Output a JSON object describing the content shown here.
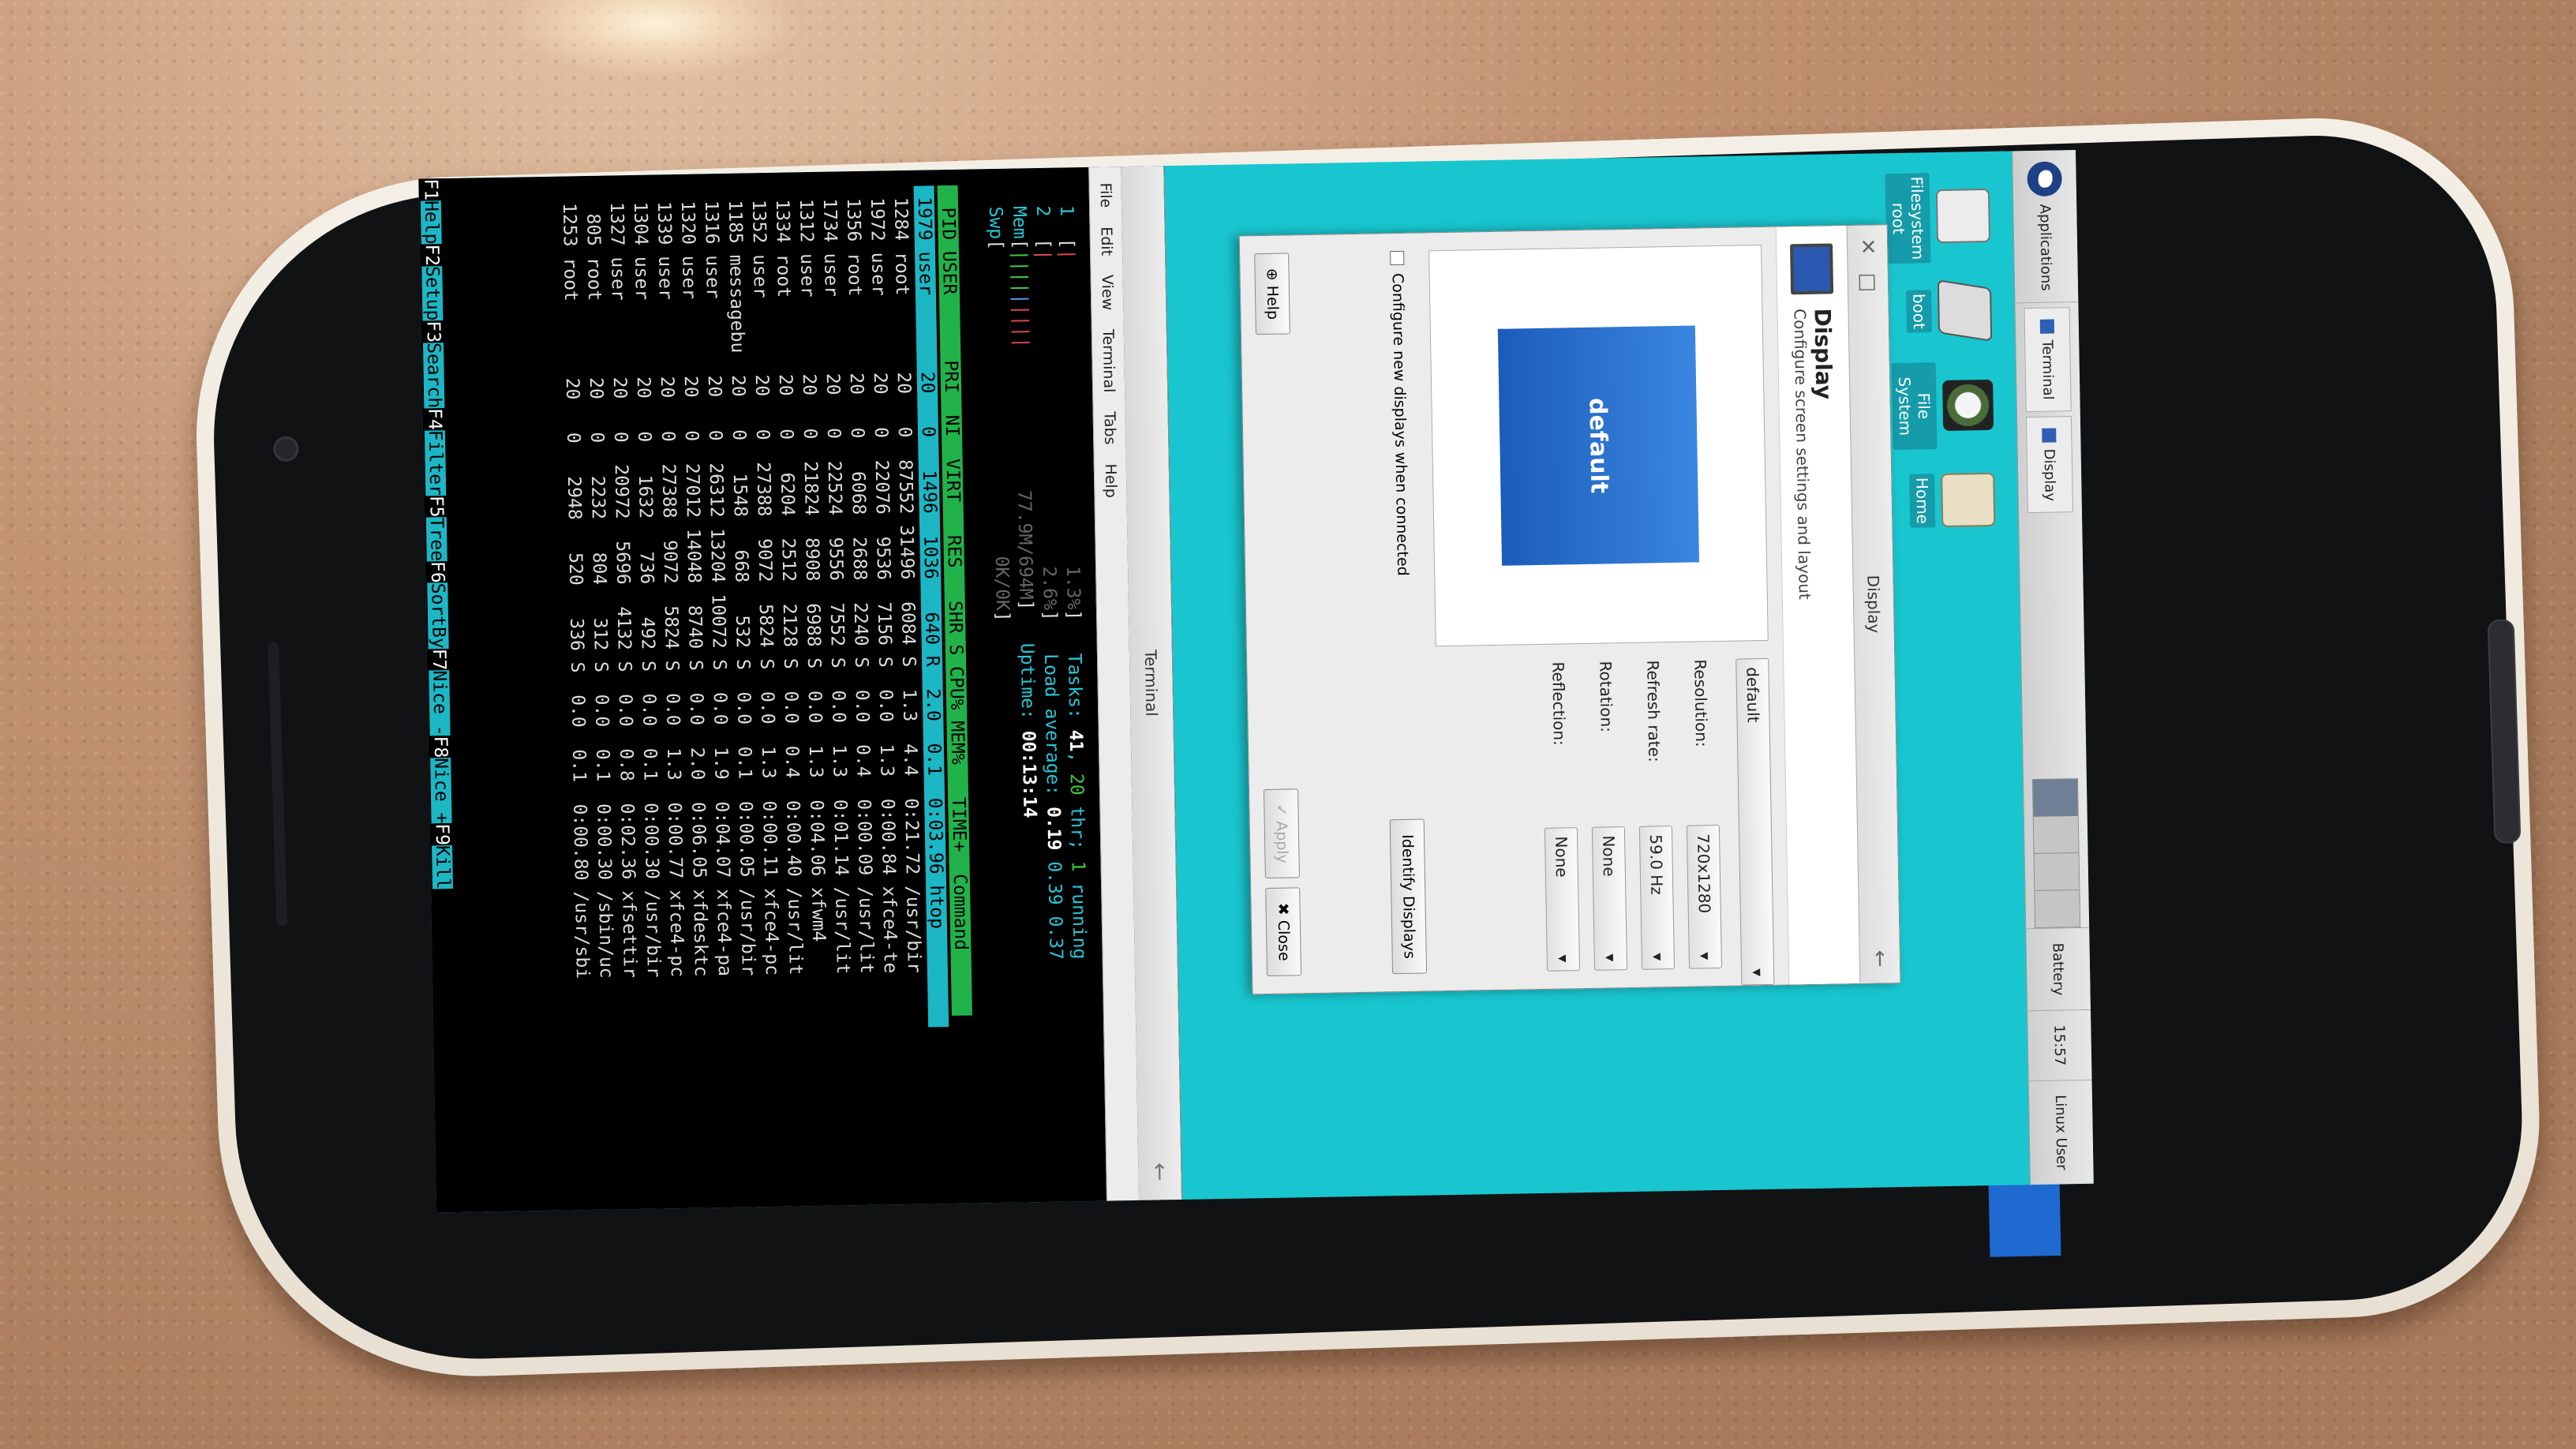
{
  "panel": {
    "applications": "Applications",
    "tasks": [
      "Terminal",
      "Display"
    ],
    "battery": "Battery",
    "clock": "15:57",
    "user": "Linux User"
  },
  "desktop_icons": [
    {
      "label": "Filesystem\nroot",
      "icon": "drive-icon"
    },
    {
      "label": "boot",
      "icon": "drive-icon"
    },
    {
      "label": "File System",
      "icon": "disk-icon"
    },
    {
      "label": "Home",
      "icon": "folder-icon"
    }
  ],
  "display_dialog": {
    "window_title": "Display",
    "heading": "Display",
    "subheading": "Configure screen settings and layout",
    "output_selected": "default",
    "preview_label": "default",
    "resolution_label": "Resolution:",
    "resolution_value": "720x1280",
    "refresh_label": "Refresh rate:",
    "refresh_value": "59.0 Hz",
    "rotation_label": "Rotation:",
    "rotation_value": "None",
    "reflection_label": "Reflection:",
    "reflection_value": "None",
    "identify_button": "Identify Displays",
    "configure_checkbox": "Configure new displays when connected",
    "help_button": "Help",
    "apply_button": "Apply",
    "close_button": "Close"
  },
  "terminal": {
    "window_title": "Terminal",
    "menu": [
      "File",
      "Edit",
      "View",
      "Terminal",
      "Tabs",
      "Help"
    ],
    "meters": {
      "cpu1": "1.3%",
      "cpu2": "2.6%",
      "mem": "77.9M/694M",
      "swp": "0K/0K"
    },
    "tasks_line": {
      "tasks": "41",
      "thr": "20",
      "running": "1"
    },
    "load_average": [
      "0.19",
      "0.39",
      "0.37"
    ],
    "uptime": "00:13:14",
    "columns": [
      "PID",
      "USER",
      "PRI",
      "NI",
      "VIRT",
      "RES",
      "SHR",
      "S",
      "CPU%",
      "MEM%",
      "TIME+",
      "Command"
    ],
    "rows": [
      [
        "1979",
        "user",
        "20",
        "0",
        "1496",
        "1036",
        "640",
        "R",
        "2.0",
        "0.1",
        "0:03.96",
        "htop"
      ],
      [
        "1284",
        "root",
        "20",
        "0",
        "87552",
        "31496",
        "6084",
        "S",
        "1.3",
        "4.4",
        "0:21.72",
        "/usr/bir"
      ],
      [
        "1972",
        "user",
        "20",
        "0",
        "22076",
        "9536",
        "7156",
        "S",
        "0.0",
        "1.3",
        "0:00.84",
        "xfce4-te"
      ],
      [
        "1356",
        "root",
        "20",
        "0",
        "6068",
        "2688",
        "2240",
        "S",
        "0.0",
        "0.4",
        "0:00.09",
        "/usr/lit"
      ],
      [
        "1734",
        "user",
        "20",
        "0",
        "22524",
        "9556",
        "7552",
        "S",
        "0.0",
        "1.3",
        "0:01.14",
        "/usr/lit"
      ],
      [
        "1312",
        "user",
        "20",
        "0",
        "21824",
        "8908",
        "6988",
        "S",
        "0.0",
        "1.3",
        "0:04.06",
        "xfwm4"
      ],
      [
        "1334",
        "root",
        "20",
        "0",
        "6204",
        "2512",
        "2128",
        "S",
        "0.0",
        "0.4",
        "0:00.40",
        "/usr/lit"
      ],
      [
        "1352",
        "user",
        "20",
        "0",
        "27388",
        "9072",
        "5824",
        "S",
        "0.0",
        "1.3",
        "0:00.11",
        "xfce4-pc"
      ],
      [
        "1185",
        "messagebu",
        "20",
        "0",
        "1548",
        "668",
        "532",
        "S",
        "0.0",
        "0.1",
        "0:00.05",
        "/usr/bir"
      ],
      [
        "1316",
        "user",
        "20",
        "0",
        "26312",
        "13204",
        "10072",
        "S",
        "0.0",
        "1.9",
        "0:04.07",
        "xfce4-pa"
      ],
      [
        "1320",
        "user",
        "20",
        "0",
        "27012",
        "14048",
        "8740",
        "S",
        "0.0",
        "2.0",
        "0:06.05",
        "xfdesktc"
      ],
      [
        "1339",
        "user",
        "20",
        "0",
        "27388",
        "9072",
        "5824",
        "S",
        "0.0",
        "1.3",
        "0:00.77",
        "xfce4-pc"
      ],
      [
        "1304",
        "user",
        "20",
        "0",
        "1632",
        "736",
        "492",
        "S",
        "0.0",
        "0.1",
        "0:00.30",
        "/usr/bir"
      ],
      [
        "1327",
        "user",
        "20",
        "0",
        "20972",
        "5696",
        "4132",
        "S",
        "0.0",
        "0.8",
        "0:02.36",
        "xfsettir"
      ],
      [
        "805",
        "root",
        "20",
        "0",
        "2232",
        "804",
        "312",
        "S",
        "0.0",
        "0.1",
        "0:00.30",
        "/sbin/uc"
      ],
      [
        "1253",
        "root",
        "20",
        "0",
        "2948",
        "520",
        "336",
        "S",
        "0.0",
        "0.1",
        "0:00.80",
        "/usr/sbi"
      ]
    ],
    "fkeys": [
      [
        "F1",
        "Help"
      ],
      [
        "F2",
        "Setup"
      ],
      [
        "F3",
        "Search"
      ],
      [
        "F4",
        "Filter"
      ],
      [
        "F5",
        "Tree"
      ],
      [
        "F6",
        "SortBy"
      ],
      [
        "F7",
        "Nice -"
      ],
      [
        "F8",
        "Nice +"
      ],
      [
        "F9",
        "Kill"
      ]
    ]
  },
  "colors": {
    "desktop": "#19c6cf",
    "htop_header": "#22b24a",
    "htop_selection": "#1cb6c4",
    "phone_body": "#f4efe6",
    "countertop": "#b8896a"
  }
}
